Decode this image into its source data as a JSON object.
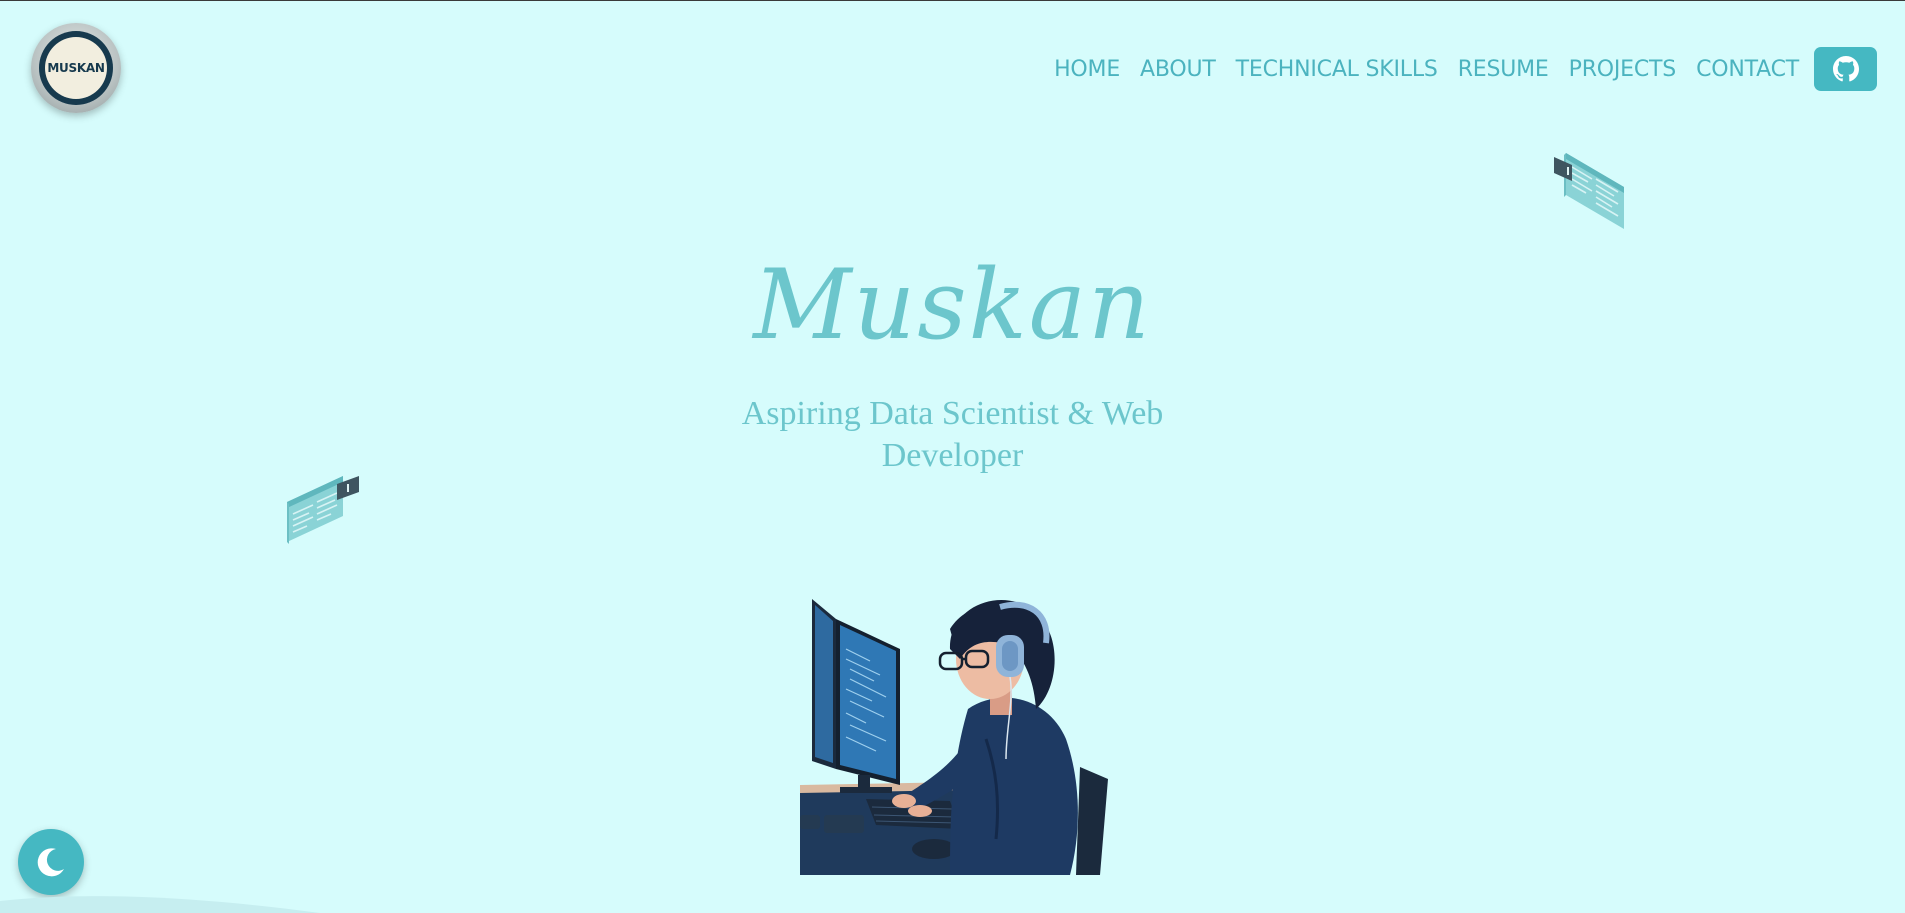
{
  "logo": {
    "text": "MUSKAN"
  },
  "nav": {
    "items": [
      {
        "label": "HOME"
      },
      {
        "label": "ABOUT"
      },
      {
        "label": "TECHNICAL SKILLS"
      },
      {
        "label": "RESUME"
      },
      {
        "label": "PROJECTS"
      },
      {
        "label": "CONTACT"
      }
    ],
    "github_icon": "github-icon"
  },
  "hero": {
    "name": "Muskan",
    "subtitle_line1": "Aspiring Data Scientist & Web",
    "subtitle_line2": "Developer"
  },
  "theme_toggle": {
    "icon": "moon-icon"
  },
  "colors": {
    "background": "#d6fcfc",
    "accent": "#45b8c2",
    "text_accent": "#6cc6cc",
    "nav_text": "#4bb3bf"
  }
}
